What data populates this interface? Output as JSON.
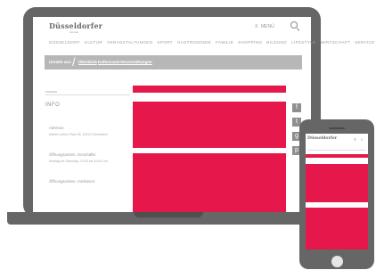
{
  "site": {
    "logo": "Düsseldorfer",
    "logo_tagline": "Journal",
    "menu_label": "MENÜ",
    "nav_items": [
      "DÜSSELDORF",
      "KULTUR",
      "VERANSTALTUNGEN",
      "SPORT",
      "GASTRONOMIE",
      "FAMILIE",
      "SHOPPING",
      "BILDUNG",
      "LIFESTYLE",
      "WIRTSCHAFT",
      "SERVICE"
    ]
  },
  "breadcrumb": {
    "first": "Unnütz aus",
    "items": [
      "Überblick",
      "Kulturraum",
      "Veranstaltungen"
    ]
  },
  "info": {
    "small_label": "ANZEIGE",
    "heading": "INFO",
    "address_title": "Adresse:",
    "address_value": "Martin-Luther-Platz 26, 40212 Düsseldorf",
    "hours1_title": "Öffnungszeiten, Geschäfte:",
    "hours1_value": "Montag bis Samstag: 10:00 bis 20:00 Uhr",
    "hours2_title": "Öffnungszeiten, Voriküsen:"
  },
  "social": [
    "f",
    "t",
    "g",
    "p"
  ],
  "phone": {
    "logo": "Düsseldorfer"
  },
  "colors": {
    "accent": "#e6174b",
    "device": "#666666",
    "crumb_bar": "#b7b7b7"
  }
}
